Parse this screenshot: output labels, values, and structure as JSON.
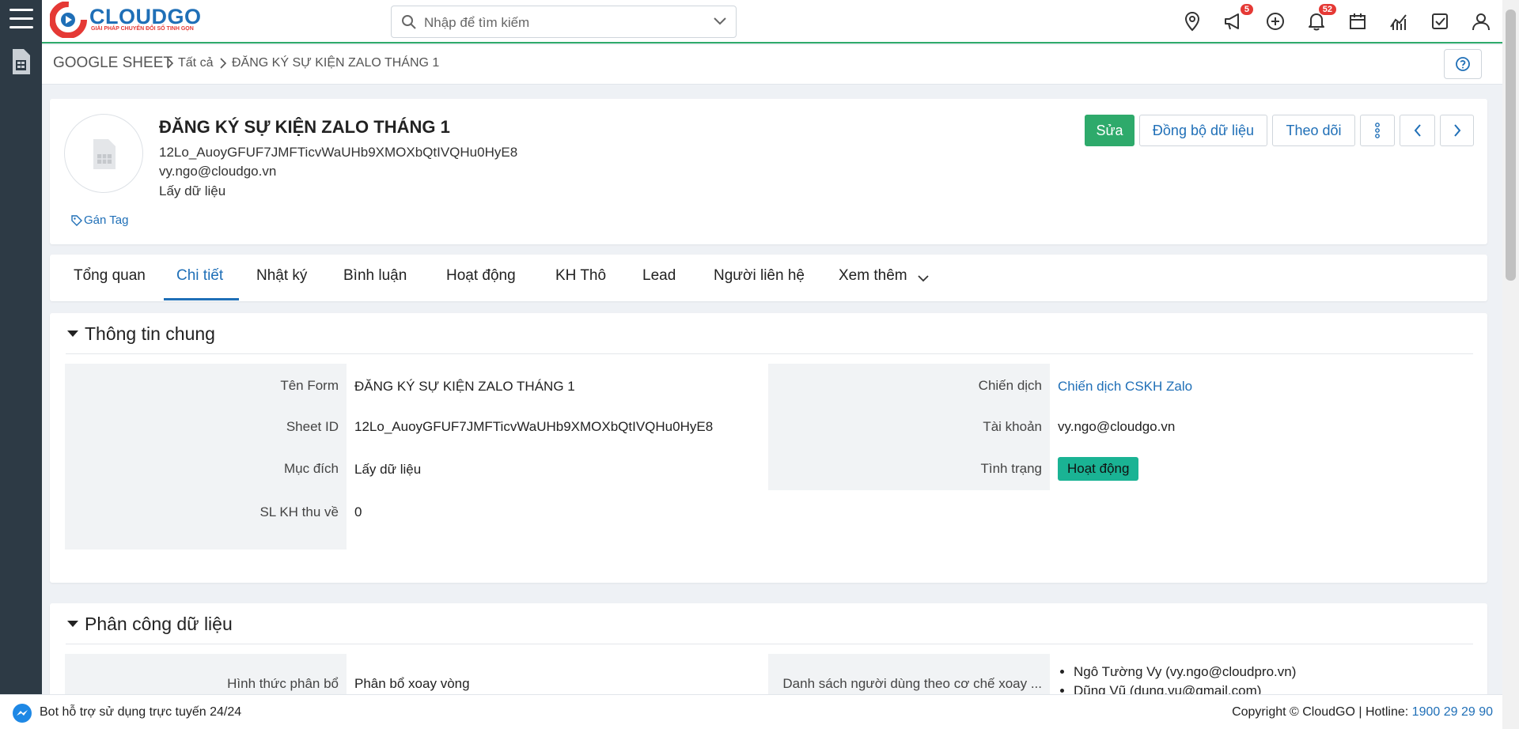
{
  "app": {
    "brand": "CLOUDGO",
    "tagline": "GIẢI PHÁP CHUYỂN ĐỔI SỐ TINH GỌN",
    "accent_color": "#2eaa6b",
    "link_color": "#1f6fb7"
  },
  "search": {
    "placeholder": "Nhập để tìm kiếm"
  },
  "topbar": {
    "icons": [
      "map-pin-icon",
      "megaphone-icon",
      "plus-circle-icon",
      "bell-icon",
      "calendar-icon",
      "chart-icon",
      "checkbox-icon",
      "user-icon"
    ],
    "megaphone_badge": "5",
    "bell_badge": "52"
  },
  "breadcrumb": {
    "module": "GOOGLE SHEET",
    "all": "Tất cả",
    "current": "ĐĂNG KÝ SỰ KIỆN ZALO THÁNG 1"
  },
  "record": {
    "title": "ĐĂNG KÝ SỰ KIỆN ZALO THÁNG 1",
    "sheet_id": "12Lo_AuoyGFUF7JMFTicvWaUHb9XMOXbQtIVQHu0HyE8",
    "email": "vy.ngo@cloudgo.vn",
    "purpose": "Lấy dữ liệu",
    "tag_label": "Gán Tag"
  },
  "actions": {
    "edit": "Sửa",
    "sync": "Đồng bộ dữ liệu",
    "follow": "Theo dõi"
  },
  "tabs": [
    {
      "label": "Tổng quan"
    },
    {
      "label": "Chi tiết"
    },
    {
      "label": "Nhật ký"
    },
    {
      "label": "Bình luận"
    },
    {
      "label": "Hoạt động"
    },
    {
      "label": "KH Thô"
    },
    {
      "label": "Lead"
    },
    {
      "label": "Người liên hệ"
    },
    {
      "label": "Xem thêm"
    }
  ],
  "general": {
    "title": "Thông tin chung",
    "left": [
      {
        "label": "Tên Form",
        "value": "ĐĂNG KÝ SỰ KIỆN ZALO THÁNG 1"
      },
      {
        "label": "Sheet ID",
        "value": "12Lo_AuoyGFUF7JMFTicvWaUHb9XMOXbQtIVQHu0HyE8"
      },
      {
        "label": "Mục đích",
        "value": "Lấy dữ liệu"
      },
      {
        "label": "SL KH thu về",
        "value": "0"
      }
    ],
    "right": [
      {
        "label": "Chiến dịch",
        "value": "Chiến dịch CSKH Zalo"
      },
      {
        "label": "Tài khoản",
        "value": "vy.ngo@cloudgo.vn"
      },
      {
        "label": "Tình trạng",
        "value": "Hoạt động"
      }
    ],
    "status_color": "#1ab394"
  },
  "assignment": {
    "title": "Phân công dữ liệu",
    "method_label": "Hình thức phân bổ",
    "method_value": "Phân bổ xoay vòng",
    "users_label": "Danh sách người dùng theo cơ chế xoay ...",
    "users": [
      "Ngô Tường Vy (vy.ngo@cloudpro.vn)",
      "Dũng Vũ (dung.vu@gmail.com)"
    ]
  },
  "footer": {
    "bot_text": "Bot hỗ trợ sử dụng trực tuyến 24/24",
    "copyright": "Copyright © CloudGO | Hotline: ",
    "hotline": "1900 29 29 90"
  }
}
